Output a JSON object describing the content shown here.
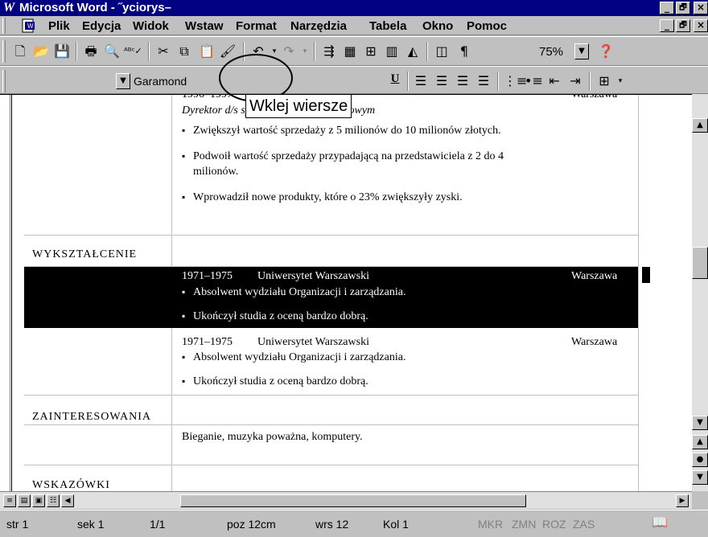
{
  "window": {
    "title": "Microsoft Word - ˝yciorys–",
    "minimize": "_",
    "restore": "🗗",
    "close": "×"
  },
  "menu": {
    "items": [
      "Plik",
      "Edycja",
      "Widok",
      "Wstaw",
      "Format",
      "Narzędzia",
      "Tabela",
      "Okno",
      "Pomoc"
    ]
  },
  "toolbar": {
    "zoom": "75%",
    "font_name": "Garamond"
  },
  "tooltip": {
    "text": "Wklej wiersze"
  },
  "document": {
    "top_partial": "1996–1997",
    "top_partial_right": "Warszawa",
    "job_title": "Dyrektor d/s sprzedaży na rynku krajowym",
    "job_bullets": [
      "Zwiększył wartość sprzedaży z 5 milionów do 10 milionów złotych.",
      "Podwoił wartość sprzedaży przypadającą na przedstawiciela z 2 do 4",
      "milionów.",
      "Wprowadził nowe produkty, które o 23% zwiększyły zyski."
    ],
    "education_heading": "WYKSZTAŁCENIE",
    "education_selected": {
      "years": "1971–1975",
      "school": "Uniwersytet Warszawski",
      "city": "Warszawa",
      "bullets": [
        "Absolwent wydziału Organizacji i zarządzania.",
        "Ukończył studia z oceną bardzo dobrą."
      ]
    },
    "education_copy": {
      "years": "1971–1975",
      "school": "Uniwersytet Warszawski",
      "city": "Warszawa",
      "bullets": [
        "Absolwent wydziału Organizacji i zarządzania.",
        "Ukończył studia z oceną bardzo dobrą."
      ]
    },
    "interests_heading": "ZAINTERESOWANIA",
    "interests_text": "Bieganie, muzyka poważna, komputery.",
    "tips_heading": "WSKAZÓWKI"
  },
  "status": {
    "page": "str 1",
    "section": "sek 1",
    "pages": "1/1",
    "position": "poz 12cm",
    "line": "wrs 12",
    "column": "Kol 1",
    "rec": "MKR",
    "trk": "ZMN",
    "ext": "ROZ",
    "ovr": "ZAS"
  }
}
